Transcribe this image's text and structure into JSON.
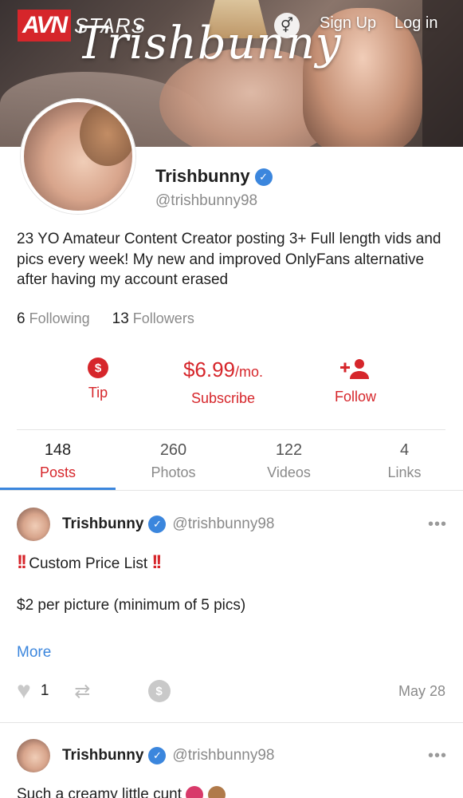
{
  "header": {
    "logo_mark": "AVN",
    "logo_text": "STARS",
    "cover_title": "Trishbunny",
    "sign_up": "Sign Up",
    "log_in": "Log in",
    "gender_icon": "⚥"
  },
  "profile": {
    "display_name": "Trishbunny",
    "handle": "@trishbunny98",
    "bio": "23 YO Amateur Content Creator posting 3+ Full length vids and pics every week! My new and improved OnlyFans alternative after having my account erased",
    "following_count": "6",
    "following_label": "Following",
    "followers_count": "13",
    "followers_label": "Followers"
  },
  "actions": {
    "tip_label": "Tip",
    "price": "$6.99",
    "price_period": "/mo.",
    "subscribe_label": "Subscribe",
    "follow_label": "Follow"
  },
  "tabs": [
    {
      "count": "148",
      "label": "Posts"
    },
    {
      "count": "260",
      "label": "Photos"
    },
    {
      "count": "122",
      "label": "Videos"
    },
    {
      "count": "4",
      "label": "Links"
    }
  ],
  "posts": [
    {
      "name": "Trishbunny",
      "handle": "@trishbunny98",
      "title_marks": "!!",
      "title": "Custom Price List",
      "line2": "$2 per picture (minimum of 5 pics)",
      "more": "More",
      "likes": "1",
      "date": "May 28"
    },
    {
      "name": "Trishbunny",
      "handle": "@trishbunny98",
      "text": "Such a creamy little cunt"
    }
  ],
  "colors": {
    "accent": "#d6262b",
    "link": "#3b86dd"
  }
}
